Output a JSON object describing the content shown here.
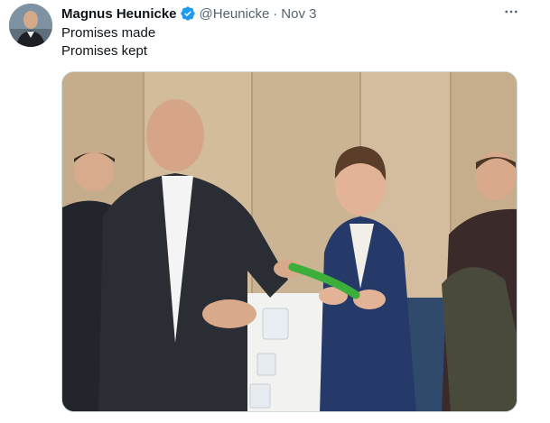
{
  "tweet": {
    "author": {
      "display_name": "Magnus Heunicke",
      "handle": "@Heunicke",
      "verified": true,
      "verified_color": "#1d9bf0",
      "avatar_icon": "profile-avatar"
    },
    "separator": "·",
    "date": "Nov 3",
    "text_lines": [
      "Promises made",
      "Promises kept"
    ],
    "more_icon": "more-horizontal-icon",
    "media": {
      "kind": "photo"
    }
  },
  "colors": {
    "text_primary": "#0f1419",
    "text_secondary": "#536471",
    "border": "#cfd9de",
    "verified_blue": "#1d9bf0"
  }
}
